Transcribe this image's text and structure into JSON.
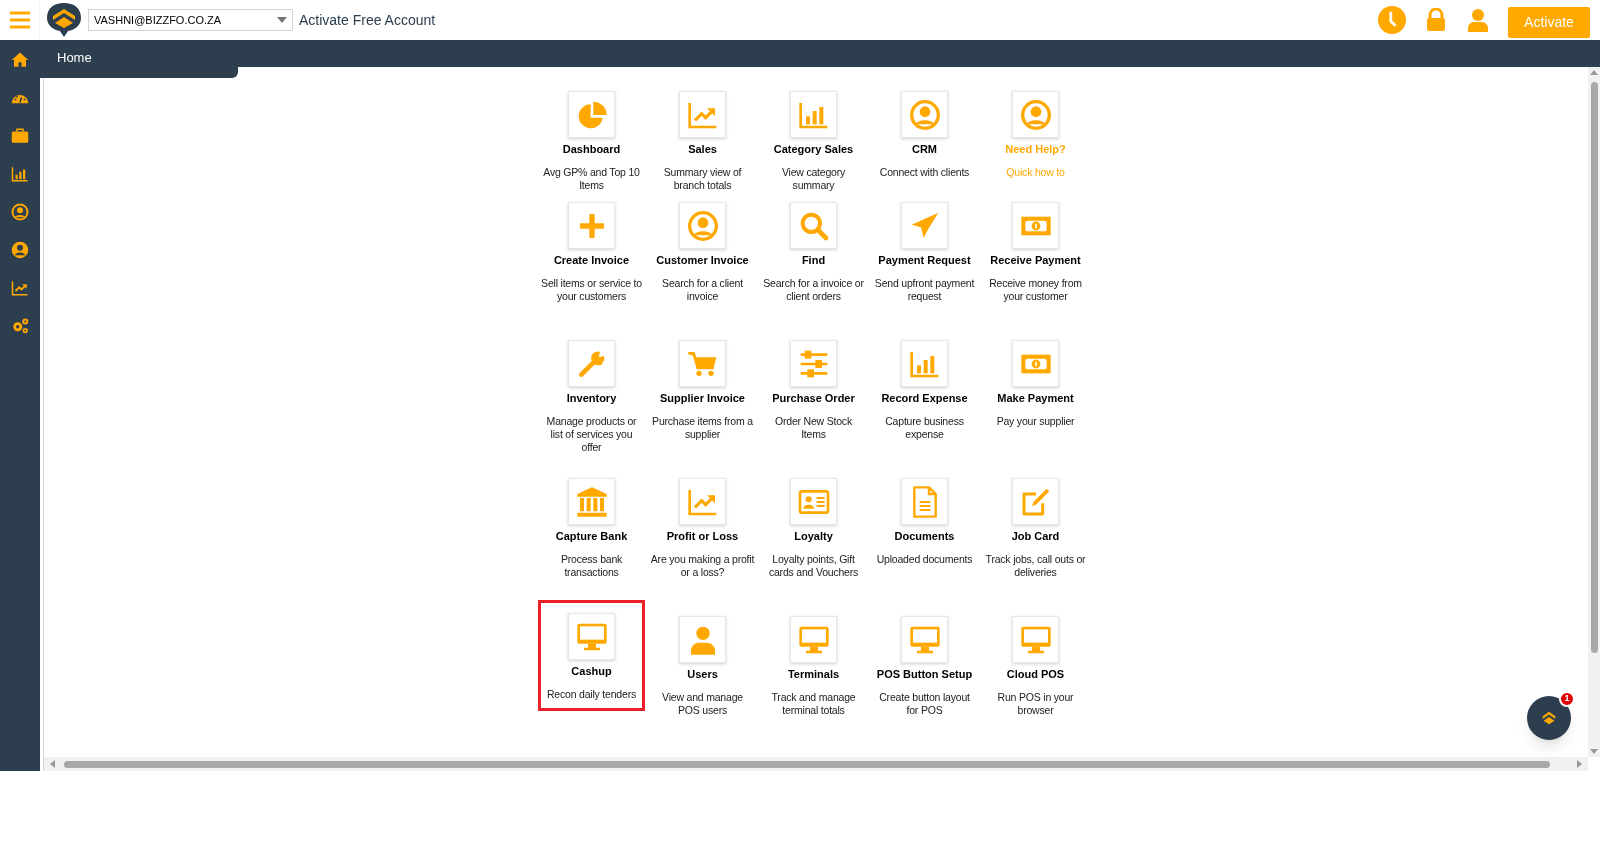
{
  "header": {
    "account_select": {
      "value": "VASHNI@BIZZFO.CO.ZA"
    },
    "link": "Activate Free Account",
    "activate_button": "Activate"
  },
  "breadcrumb_tab": {
    "label": "Home"
  },
  "tiles": [
    {
      "title": "Dashboard",
      "description": "Avg GP% and Top 10 Items",
      "kind": "tool",
      "highlighted": false
    },
    {
      "title": "Sales",
      "description": "Summary view of branch totals",
      "kind": "tool",
      "highlighted": false
    },
    {
      "title": "Category Sales",
      "description": "View category summary",
      "kind": "tool",
      "highlighted": false
    },
    {
      "title": "CRM",
      "description": "Connect with clients",
      "kind": "tool",
      "highlighted": false
    },
    {
      "title": "Need Help?",
      "description": "Quick how to",
      "kind": "help",
      "highlighted": false
    },
    {
      "title": "Create Invoice",
      "description": "Sell items or service to your customers",
      "kind": "tool",
      "highlighted": false
    },
    {
      "title": "Customer Invoice",
      "description": "Search for a client invoice",
      "kind": "tool",
      "highlighted": false
    },
    {
      "title": "Find",
      "description": "Search for a invoice or client orders",
      "kind": "tool",
      "highlighted": false
    },
    {
      "title": "Payment Request",
      "description": "Send upfront payment request",
      "kind": "tool",
      "highlighted": false
    },
    {
      "title": "Receive Payment",
      "description": "Receive money from your customer",
      "kind": "tool",
      "highlighted": false
    },
    {
      "title": "Inventory",
      "description": "Manage products or list of services you offer",
      "kind": "tool",
      "highlighted": false
    },
    {
      "title": "Supplier Invoice",
      "description": "Purchase items from a supplier",
      "kind": "tool",
      "highlighted": false
    },
    {
      "title": "Purchase Order",
      "description": "Order New Stock Items",
      "kind": "tool",
      "highlighted": false
    },
    {
      "title": "Record Expense",
      "description": "Capture business expense",
      "kind": "tool",
      "highlighted": false
    },
    {
      "title": "Make Payment",
      "description": "Pay your supplier",
      "kind": "tool",
      "highlighted": false
    },
    {
      "title": "Capture Bank",
      "description": "Process bank transactions",
      "kind": "tool",
      "highlighted": false
    },
    {
      "title": "Profit or Loss",
      "description": "Are you making a profit or a loss?",
      "kind": "tool",
      "highlighted": false
    },
    {
      "title": "Loyalty",
      "description": "Loyalty points, Gift cards and Vouchers",
      "kind": "tool",
      "highlighted": false
    },
    {
      "title": "Documents",
      "description": "Uploaded documents",
      "kind": "tool",
      "highlighted": false
    },
    {
      "title": "Job Card",
      "description": "Track jobs, call outs or deliveries",
      "kind": "tool",
      "highlighted": false
    },
    {
      "title": "Cashup",
      "description": "Recon daily tenders",
      "kind": "tool",
      "highlighted": true
    },
    {
      "title": "Users",
      "description": "View and manage POS users",
      "kind": "tool",
      "highlighted": false
    },
    {
      "title": "Terminals",
      "description": "Track and manage terminal totals",
      "kind": "tool",
      "highlighted": false
    },
    {
      "title": "POS Button Setup",
      "description": "Create button layout for POS",
      "kind": "tool",
      "highlighted": false
    },
    {
      "title": "Cloud POS",
      "description": "Run POS in your browser",
      "kind": "tool",
      "highlighted": false
    }
  ],
  "chat_button": {
    "badge": "1"
  }
}
